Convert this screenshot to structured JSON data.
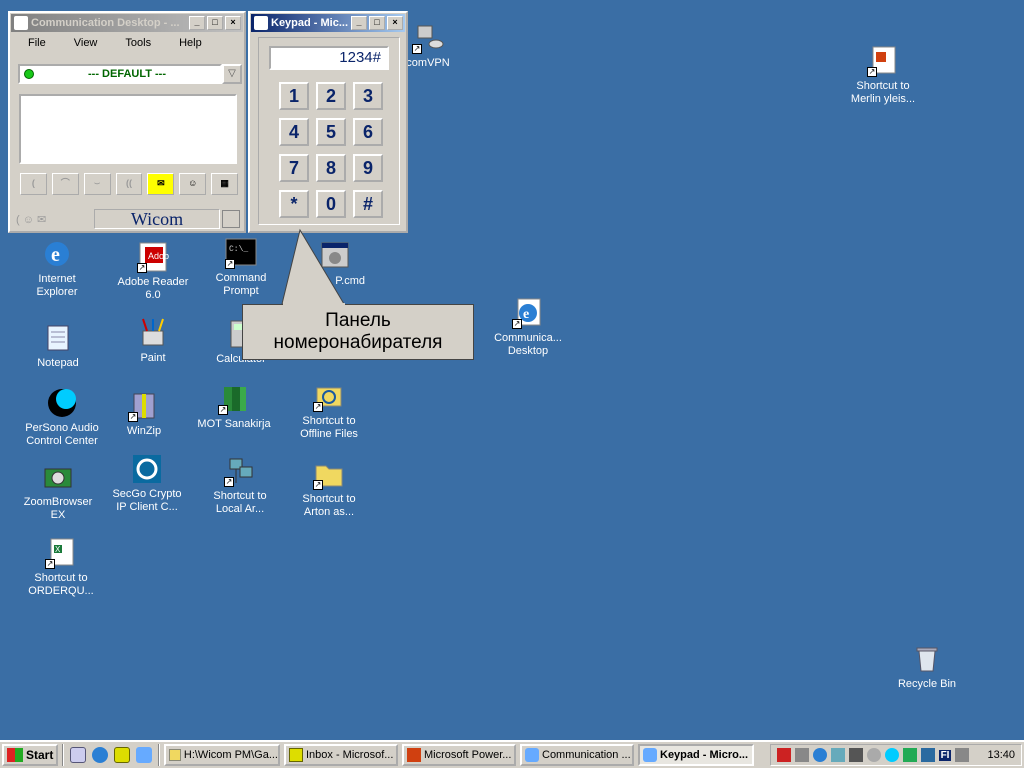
{
  "desktop": {
    "icons": [
      {
        "label": "Internet Explorer"
      },
      {
        "label": "Adobe Reader 6.0"
      },
      {
        "label": "Command Prompt"
      },
      {
        "label": "comVPN"
      },
      {
        "label": "Notepad"
      },
      {
        "label": "Paint"
      },
      {
        "label": "Calculator"
      },
      {
        "label": "Communica... Desktop"
      },
      {
        "label": "PerSono Audio Control Center"
      },
      {
        "label": "WinZip"
      },
      {
        "label": "MOT Sanakirja"
      },
      {
        "label": "Shortcut to Offline Files"
      },
      {
        "label": "ZoomBrowser EX"
      },
      {
        "label": "SecGo Crypto IP Client C..."
      },
      {
        "label": "Shortcut to Local Ar..."
      },
      {
        "label": "Shortcut to Arton as..."
      },
      {
        "label": "Shortcut to ORDERQU..."
      },
      {
        "label": "Shortcut to Merlin yleis..."
      },
      {
        "label": "Recycle Bin"
      },
      {
        "label": "P.cmd"
      }
    ]
  },
  "comm_window": {
    "title": "Communication Desktop - ...",
    "menu": [
      "File",
      "View",
      "Tools",
      "Help"
    ],
    "profile": "--- DEFAULT ---",
    "brand": "Wicom"
  },
  "keypad_window": {
    "title": "Keypad - Mic...",
    "display": "1234#",
    "keys": [
      "1",
      "2",
      "3",
      "4",
      "5",
      "6",
      "7",
      "8",
      "9",
      "*",
      "0",
      "#"
    ]
  },
  "callout": {
    "line1": "Панель",
    "line2": "номеронабирателя"
  },
  "taskbar": {
    "start": "Start",
    "tasks": [
      {
        "label": "H:\\Wicom PM\\Ga..."
      },
      {
        "label": "Inbox - Microsof..."
      },
      {
        "label": "Microsoft Power..."
      },
      {
        "label": "Communication ..."
      },
      {
        "label": "Keypad - Micro..."
      }
    ],
    "tray_lang": "FI",
    "clock": "13:40"
  }
}
